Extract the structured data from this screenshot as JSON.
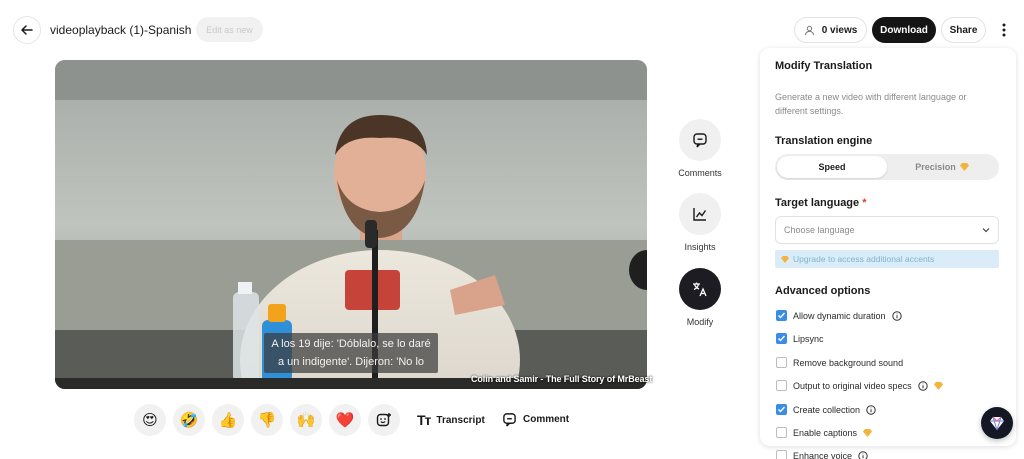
{
  "header": {
    "back_icon": "arrow-left-icon",
    "title": "videoplayback (1)-Spanish",
    "edit_as_new": "Edit as new",
    "views": "0 views",
    "download": "Download",
    "share": "Share"
  },
  "video": {
    "subtitle_line1": "A los 19 dije: 'Dóblalo, se lo daré",
    "subtitle_line2": "a un indigente'. Dijeron: 'No lo",
    "watermark": "Colin and Samir - The Full Story of MrBeast"
  },
  "side_actions": [
    {
      "label": "Comments",
      "icon": "comment-icon"
    },
    {
      "label": "Insights",
      "icon": "chart-icon"
    },
    {
      "label": "Modify",
      "icon": "translate-icon"
    }
  ],
  "reactions": [
    "😍",
    "🤣",
    "👍",
    "👎",
    "🙌",
    "❤️"
  ],
  "toolbar": {
    "transcript": "Transcript",
    "comment": "Comment"
  },
  "panel": {
    "title": "Modify Translation",
    "description": "Generate a new video with different language or different settings.",
    "engine_title": "Translation engine",
    "engine_speed": "Speed",
    "engine_precision": "Precision",
    "target_title": "Target language",
    "target_required": "*",
    "target_placeholder": "Choose language",
    "upgrade_text": "Upgrade to access additional accents",
    "advanced_title": "Advanced options",
    "options": [
      {
        "label": "Allow dynamic duration",
        "checked": true,
        "info": true,
        "premium": false
      },
      {
        "label": "Lipsync",
        "checked": true,
        "info": false,
        "premium": false
      },
      {
        "label": "Remove background sound",
        "checked": false,
        "info": false,
        "premium": false
      },
      {
        "label": "Output to original video specs",
        "checked": false,
        "info": true,
        "premium": true
      },
      {
        "label": "Create collection",
        "checked": true,
        "info": true,
        "premium": false
      },
      {
        "label": "Enable captions",
        "checked": false,
        "info": false,
        "premium": true
      },
      {
        "label": "Enhance voice",
        "checked": false,
        "info": true,
        "premium": false
      }
    ]
  },
  "colors": {
    "accent": "#3a8de6",
    "premium": "#f3b33d",
    "dark": "#151515"
  }
}
